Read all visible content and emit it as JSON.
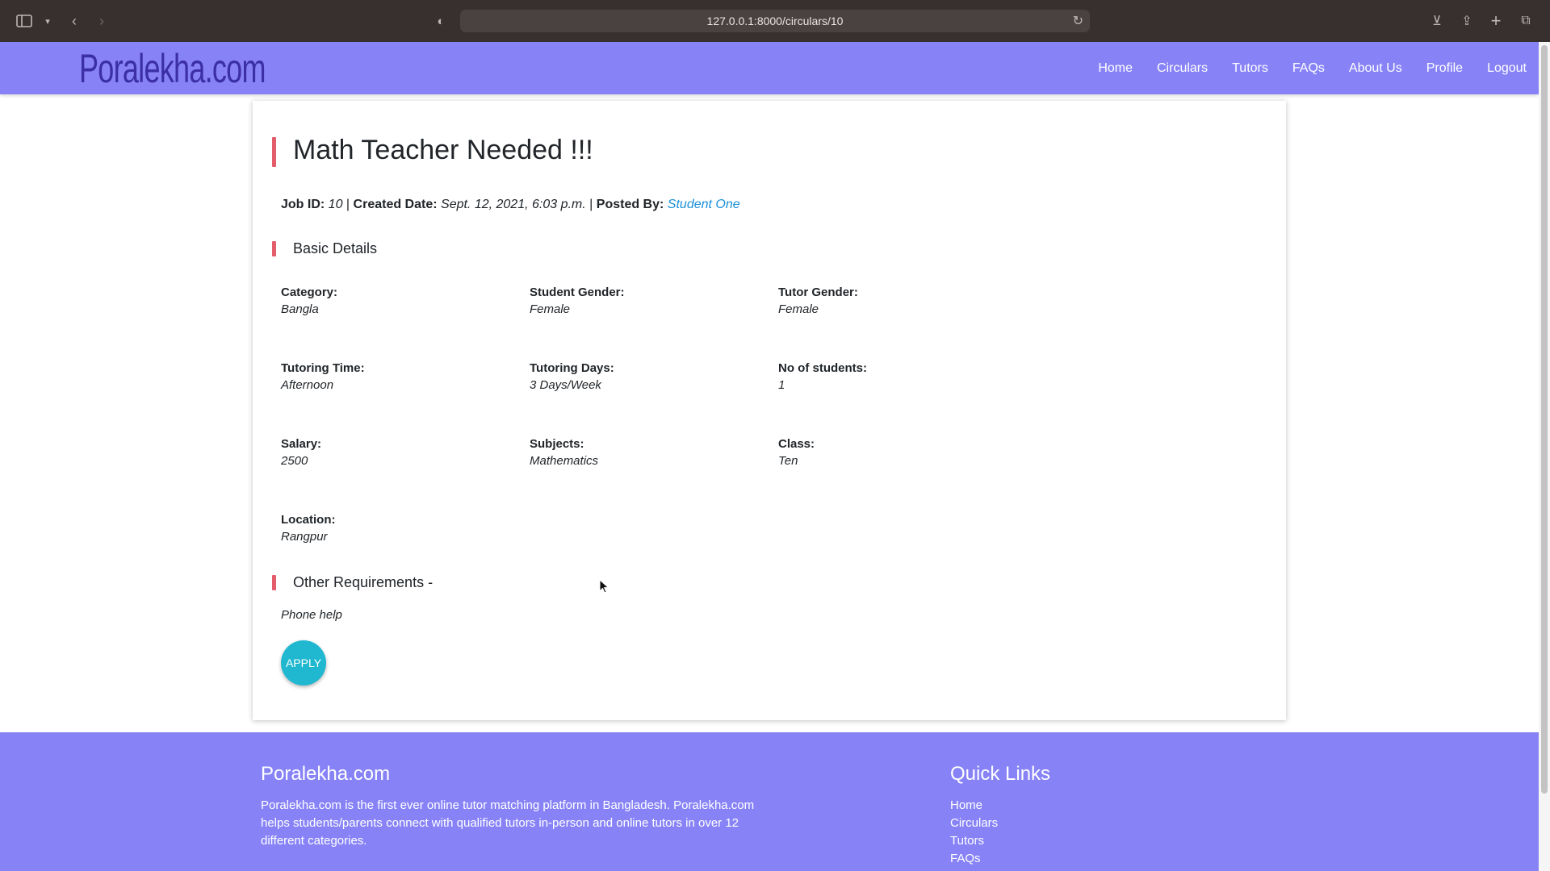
{
  "browser": {
    "url": "127.0.0.1:8000/circulars/10"
  },
  "navbar": {
    "brand": "Poralekha.com",
    "links": [
      "Home",
      "Circulars",
      "Tutors",
      "FAQs",
      "About Us",
      "Profile",
      "Logout"
    ]
  },
  "circular": {
    "title": "Math Teacher Needed !!!",
    "meta": {
      "job_id_label": "Job ID:",
      "job_id": "10",
      "created_label": "Created Date:",
      "created": "Sept. 12, 2021, 6:03 p.m.",
      "posted_label": "Posted By:",
      "posted_by": "Student One",
      "separator": "|"
    },
    "basic_details_title": "Basic Details",
    "fields": {
      "category": {
        "label": "Category:",
        "value": "Bangla"
      },
      "student_gender": {
        "label": "Student Gender:",
        "value": "Female"
      },
      "tutor_gender": {
        "label": "Tutor Gender:",
        "value": "Female"
      },
      "tutoring_time": {
        "label": "Tutoring Time:",
        "value": "Afternoon"
      },
      "tutoring_days": {
        "label": "Tutoring Days:",
        "value": "3 Days/Week"
      },
      "no_of_students": {
        "label": "No of students:",
        "value": "1"
      },
      "salary": {
        "label": "Salary:",
        "value": "2500"
      },
      "subjects": {
        "label": "Subjects:",
        "value": "Mathematics"
      },
      "class": {
        "label": "Class:",
        "value": "Ten"
      },
      "location": {
        "label": "Location:",
        "value": "Rangpur"
      }
    },
    "other_requirements_title": "Other Requirements -",
    "other_requirements": "Phone help",
    "apply_label": "APPLY"
  },
  "footer": {
    "title": "Poralekha.com",
    "description": "Poralekha.com is the first ever online tutor matching platform in Bangladesh. Poralekha.com helps students/parents connect with qualified tutors in-person and online tutors in over 12 different categories.",
    "quick_links_title": "Quick Links",
    "quick_links": [
      "Home",
      "Circulars",
      "Tutors",
      "FAQs"
    ]
  },
  "colors": {
    "navbar_bg": "#8783f7",
    "accent_bar": "#e35d6a",
    "apply_button": "#1fb8d0",
    "link": "#1a8fd8"
  }
}
